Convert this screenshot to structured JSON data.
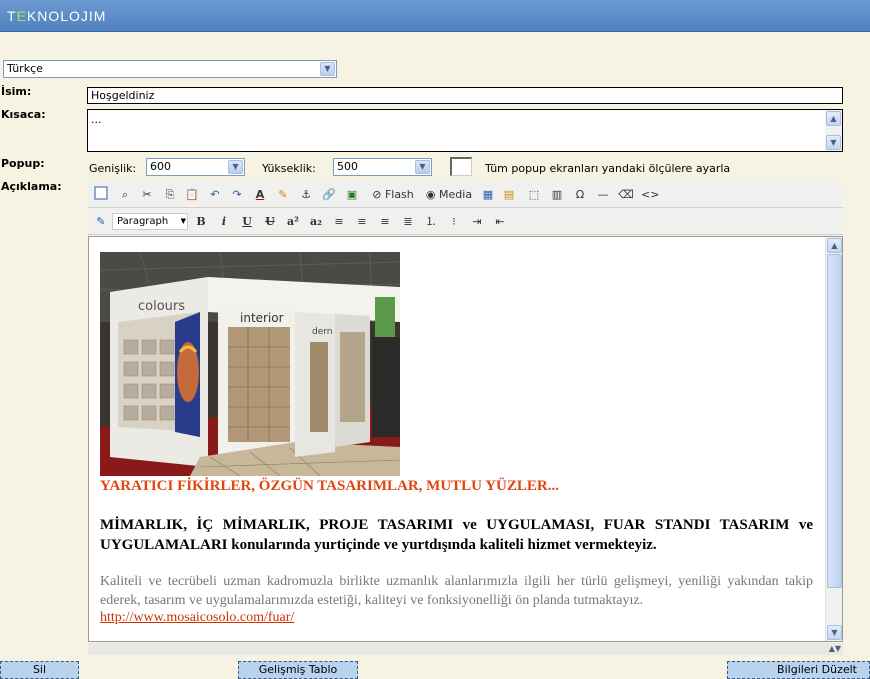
{
  "brand": {
    "logo_pre": "T",
    "logo_e": "E",
    "logo_post": "KNOLOJIM"
  },
  "language": {
    "selected": "Türkçe"
  },
  "form": {
    "isim_label": "İsim:",
    "isim_value": "Hoşgeldiniz",
    "kisaca_label": "Kısaca:",
    "kisaca_value": "...",
    "popup_label": "Popup:",
    "genislik_label": "Genişlik:",
    "genislik_value": "600",
    "yukseklik_label": "Yükseklik:",
    "yukseklik_value": "500",
    "popup_all_label": "Tüm popup ekranları yandaki ölçülere ayarla",
    "aciklama_label": "Açıklama:"
  },
  "toolbar": {
    "flash_label": "Flash",
    "media_label": "Media",
    "format_value": "Paragraph"
  },
  "content": {
    "heading": "YARATICI FİKİRLER, ÖZGÜN TASARIMLAR, MUTLU YÜZLER...",
    "bold_para": "MİMARLIK, İÇ MİMARLIK, PROJE TASARIMI ve UYGULAMASI, FUAR STANDI TASARIM ve UYGULAMALARI konularında yurtiçinde ve yurtdışında kaliteli hizmet vermekteyiz.",
    "gray_para": "Kaliteli ve tecrübeli uzman kadromuzla birlikte uzmanlık alanlarımızla ilgili her türlü gelişmeyi, yeniliği yakından takip ederek, tasarım ve uygulamalarımızda estetiği, kaliteyi ve fonksiyonelliği ön planda tutmaktayız.",
    "link": "http://www.mosaicosolo.com/fuar/",
    "image_text_colours": "colours",
    "image_text_interior": "interior",
    "image_text_modern": "dern"
  },
  "buttons": {
    "sil": "Sil",
    "gelismis_tablo": "Gelişmiş Tablo",
    "bilgileri_duzelt": "Bilgileri Düzelt"
  },
  "colors": {
    "heading": "#e2450f",
    "gray_text": "#777777",
    "link": "#cc3300",
    "topbar": "#5a8cc8"
  }
}
